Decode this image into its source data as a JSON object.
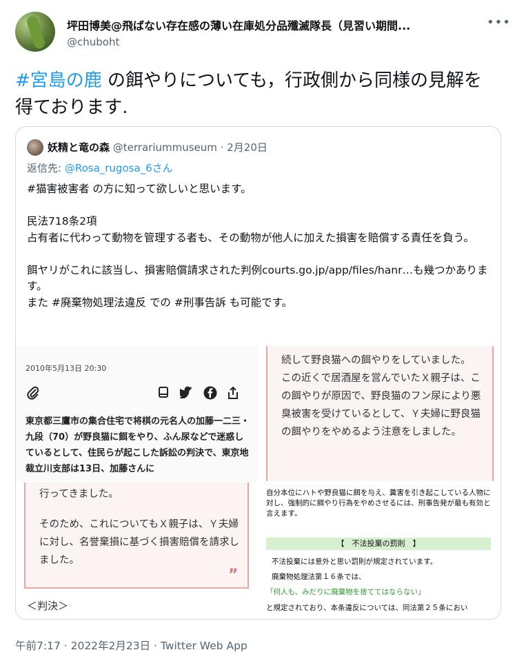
{
  "author": {
    "name": "坪田博美@飛ばない存在感の薄い在庫処分品殲滅隊長（見習い期間...",
    "handle": "@chuboht",
    "more_icon": "more-icon"
  },
  "tweet": {
    "hashtag": "#宮島の鹿",
    "text_rest": " の餌やりについても，行政側から同様の見解を得ております."
  },
  "quote": {
    "name": "妖精と竜の森",
    "handle": "@terrariummuseum",
    "separator": "·",
    "date": "2月20日",
    "reply_prefix": "返信先: ",
    "reply_to": "@Rosa_rugosa_6さん",
    "lines": [
      "#猫害被害者 の方に知って欲しいと思います。",
      "",
      "民法718条2項",
      "占有者に代わって動物を管理する者も、その動物が他人に加えた損害を賠償する責任を負う。",
      "",
      "餌ヤリがこれに該当し、損害賠償請求された判例courts.go.jp/app/files/hanr…も幾つかあります。",
      "また #廃棄物処理法違反 での #刑事告訴 も可能です。"
    ]
  },
  "media": {
    "news": {
      "date": "2010年5月13日 20:30",
      "body": "東京都三鷹市の集合住宅で将棋の元名人の加藤一二三・九段（70）が野良猫に餌をやり、ふん尿などで迷惑しているとして、住民らが起こした訴訟の判決で、東京地裁立川支部は13日、加藤さんに"
    },
    "top_right": [
      "続して野良猫への餌やりをしていました。",
      "この近くで居酒屋を営んでいたＸ親子は、この餌やりが原因で、野良猫のフン尿により悪臭被害を受けているとして、Ｙ夫婦に野良猫の餌やりをやめるよう注意をしました。"
    ],
    "bottom_left": [
      "行ってきました。",
      "そのため、これについてもＸ親子は、Ｙ夫婦に対し、名誉棄損に基づく損害賠償を請求しました。"
    ],
    "bottom_left_quote": "99",
    "bottom_left_caption": "＜判決＞",
    "bottom_right": {
      "para1": "自分本位にハトや野良猫に餌を与え、糞害を引き起こしている人物に対し、強制的に餌やり行為をやめさせるには、刑事告発が最も有効と言えます。",
      "heading": "【　不法投棄の罰則　】",
      "para2": "不法投棄には意外と思い罰則が規定されています。",
      "para3": "廃棄物処理法第１６条では、",
      "quote": "「何人も、みだりに廃棄物を捨ててはならない」",
      "para4": "と規定されており、本条違反については、同法第２５条におい"
    }
  },
  "footer": {
    "time": "午前7:17",
    "sep1": " · ",
    "date": "2022年2月23日",
    "sep2": " · ",
    "app": "Twitter Web App"
  }
}
